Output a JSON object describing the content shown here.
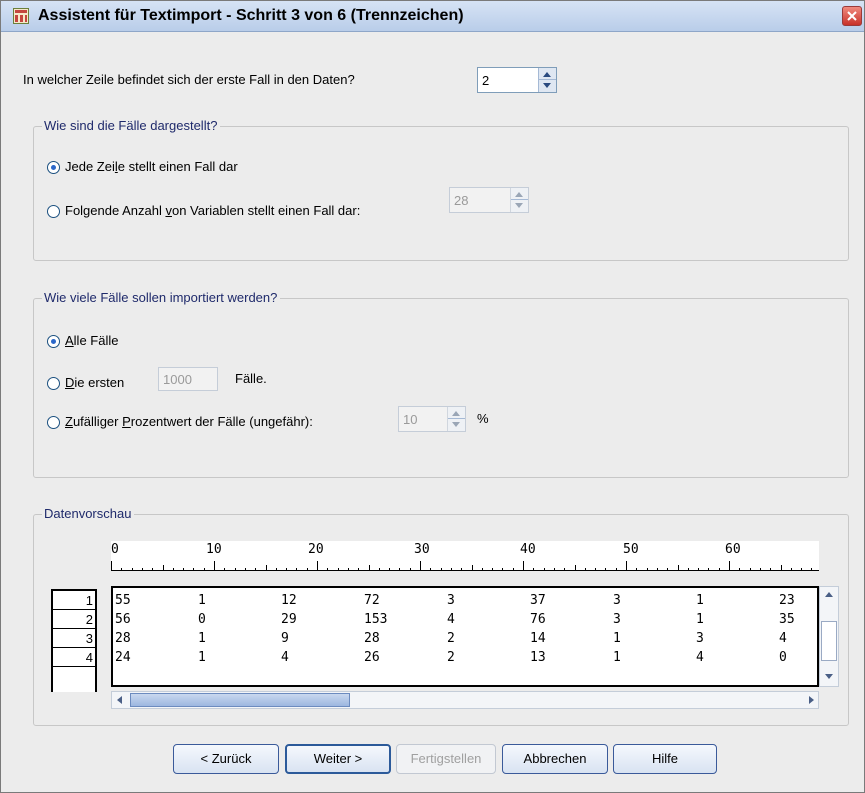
{
  "window": {
    "title": "Assistent für Textimport - Schritt 3 von 6 (Trennzeichen)"
  },
  "first_case_row": {
    "label": "In welcher Zeile befindet sich der erste Fall in den Daten?",
    "value": "2"
  },
  "cases_representation": {
    "legend": "Wie sind die Fälle dargestellt?",
    "option1": {
      "pre": "Jede Zei",
      "acc": "l",
      "post": "e stellt einen Fall dar",
      "selected": true
    },
    "option2": {
      "pre": "Folgende Anzahl ",
      "acc": "v",
      "post": "on Variablen stellt einen Fall dar:",
      "selected": false
    },
    "variables_count": "28"
  },
  "cases_import": {
    "legend": "Wie viele Fälle sollen importiert werden?",
    "option_all": {
      "acc": "A",
      "post": "lle Fälle",
      "selected": true
    },
    "option_first": {
      "acc": "D",
      "post": "ie ersten",
      "selected": false
    },
    "first_count": "1000",
    "first_suffix": "Fälle.",
    "option_random": {
      "acc": "Z",
      "mid": "ufälliger ",
      "acc2": "P",
      "post": "rozentwert der Fälle (ungefähr):",
      "selected": false
    },
    "random_percent": "10",
    "percent_symbol": "%"
  },
  "preview": {
    "legend": "Datenvorschau",
    "ruler_labels": [
      "0",
      "10",
      "20",
      "30",
      "40",
      "50",
      "60"
    ],
    "row_numbers": [
      "1",
      "2",
      "3",
      "4"
    ],
    "rows": [
      [
        "55",
        "1",
        "12",
        "72",
        "3",
        "37",
        "3",
        "1",
        "23"
      ],
      [
        "56",
        "0",
        "29",
        "153",
        "4",
        "76",
        "3",
        "1",
        "35"
      ],
      [
        "28",
        "1",
        "9",
        "28",
        "2",
        "14",
        "1",
        "3",
        "4"
      ],
      [
        "24",
        "1",
        "4",
        "26",
        "2",
        "13",
        "1",
        "4",
        "0"
      ]
    ]
  },
  "buttons": {
    "back": "< Zurück",
    "next": "Weiter >",
    "finish": "Fertigstellen",
    "cancel": "Abbrechen",
    "help": "Hilfe"
  },
  "icons": {
    "app": "table-import-icon",
    "close": "close-icon"
  },
  "colors": {
    "titlebar": "#c9d8ef",
    "radio_selected": "#2b67c9",
    "group_legend_text": "#1f2a6b",
    "close_button": "#d8463c"
  }
}
